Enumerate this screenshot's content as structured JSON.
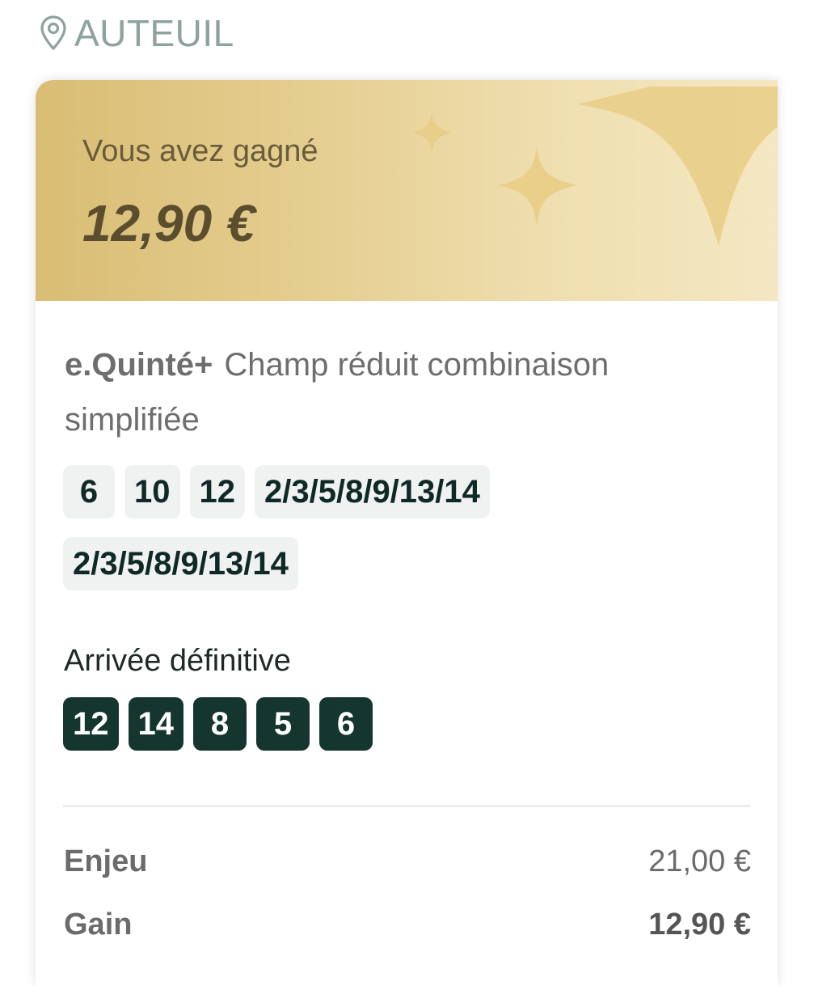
{
  "location": {
    "icon": "map-pin-icon",
    "name": "AUTEUIL"
  },
  "banner": {
    "label": "Vous avez gagné",
    "amount": "12,90 €",
    "colors": {
      "start": "#d9bd74",
      "end": "#f4e7c2",
      "sparkle": "#e8cd85"
    }
  },
  "bet": {
    "type": "e.Quinté+",
    "description": "Champ réduit combinaison simplifiée",
    "selections_row1": [
      "6",
      "10",
      "12",
      "2/3/5/8/9/13/14"
    ],
    "selections_row2": [
      "2/3/5/8/9/13/14"
    ]
  },
  "arrival": {
    "label": "Arrivée définitive",
    "numbers": [
      "12",
      "14",
      "8",
      "5",
      "6"
    ],
    "color": "#15352f"
  },
  "summary": {
    "stake_label": "Enjeu",
    "stake_value": "21,00 €",
    "gain_label": "Gain",
    "gain_value": "12,90 €"
  }
}
